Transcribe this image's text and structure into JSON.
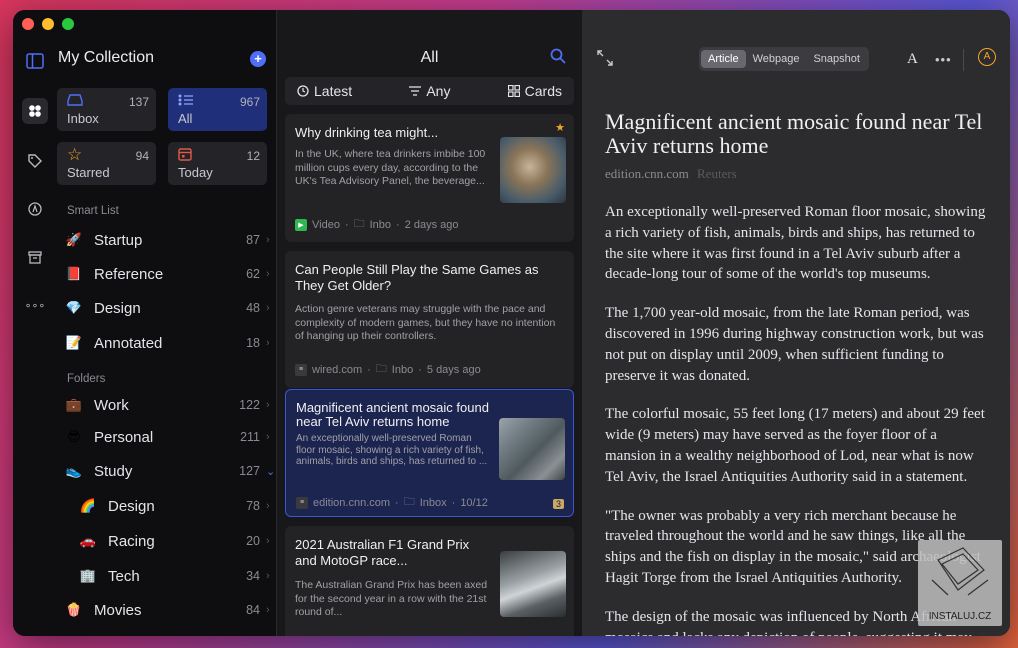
{
  "sidebar": {
    "collection_title": "My Collection",
    "add_icon": "plus-icon",
    "tiles": [
      {
        "label": "Inbox",
        "count": "137",
        "icon": "inbox-icon"
      },
      {
        "label": "All",
        "count": "967",
        "icon": "list-icon"
      },
      {
        "label": "Starred",
        "count": "94",
        "icon": "star-icon"
      },
      {
        "label": "Today",
        "count": "12",
        "icon": "calendar-icon"
      }
    ],
    "smart_list_title": "Smart List",
    "smart_list": [
      {
        "label": "Startup",
        "count": "87",
        "icon": "🚀"
      },
      {
        "label": "Reference",
        "count": "62",
        "icon": "📕"
      },
      {
        "label": "Design",
        "count": "48",
        "icon": "💎"
      },
      {
        "label": "Annotated",
        "count": "18",
        "icon": "📝"
      }
    ],
    "folders_title": "Folders",
    "folders": [
      {
        "label": "Work",
        "count": "122",
        "icon": "💼"
      },
      {
        "label": "Personal",
        "count": "211",
        "icon": "😎"
      },
      {
        "label": "Study",
        "count": "127",
        "icon": "👟"
      },
      {
        "label": "Design",
        "count": "78",
        "icon": "🌈"
      },
      {
        "label": "Racing",
        "count": "20",
        "icon": "🚗"
      },
      {
        "label": "Tech",
        "count": "34",
        "icon": "🏢"
      },
      {
        "label": "Movies",
        "count": "84",
        "icon": "🍿"
      }
    ]
  },
  "list": {
    "title": "All",
    "filters": {
      "sort": "Latest",
      "filter": "Any",
      "view": "Cards"
    },
    "cards": [
      {
        "title": "Why drinking tea might...",
        "excerpt": "In the UK, where tea drinkers imbibe 100 million cups every day, according to the UK's Tea Advisory Panel, the beverage...",
        "type": "Video",
        "folder": "Inbo",
        "time": "2 days ago"
      },
      {
        "title": "Can People Still Play the Same Games as They Get Older?",
        "excerpt": "Action genre veterans may struggle with the pace and complexity of modern games, but they have no intention of hanging up their controllers.",
        "source": "wired.com",
        "folder": "Inbo",
        "time": "5 days ago"
      },
      {
        "title": "Magnificent ancient mosaic found near Tel Aviv returns home",
        "excerpt": "An exceptionally well-preserved Roman floor mosaic, showing a rich variety of fish, animals, birds and ships, has returned to ...",
        "source": "edition.cnn.com",
        "folder": "Inbox",
        "time": "10/12",
        "badge": "3"
      },
      {
        "title": "2021 Australian F1 Grand Prix and MotoGP race...",
        "excerpt": "The Australian Grand Prix has been axed for the second year in a row with the 21st round of..."
      }
    ]
  },
  "reader": {
    "segments": [
      "Article",
      "Webpage",
      "Snapshot"
    ],
    "title": "Magnificent ancient mosaic found near Tel Aviv returns home",
    "source": "edition.cnn.com",
    "author": "Reuters",
    "paragraphs": [
      "An exceptionally well-preserved Roman floor mosaic, showing a rich variety of fish, animals, birds and ships, has returned to the site where it was first found in a Tel Aviv suburb after a decade-long tour of some of the world's top museums.",
      "The 1,700 year-old mosaic, from the late Roman period, was discovered in 1996 during highway construction work, but was not put on display until 2009, when sufficient funding to preserve it was donated.",
      "The colorful mosaic, 55 feet long (17 meters) and about 29 feet wide (9 meters) may have served as the foyer floor of a mansion in a wealthy neighborhood of Lod, near what is now Tel Aviv, the Israel Antiquities Authority said in a statement.",
      "\"The owner was probably a very rich merchant because he traveled throughout the world and he saw things, like all the ships and the fish on display in the mosaic,\" said archaeologist Hagit Torge from the Israel Antiquities Authority.",
      "The design of the mosaic was influenced by North African mosaics and lacks any depiction of people, suggesting it may"
    ],
    "font_button": "A",
    "more_button": "•••"
  },
  "watermark": {
    "text": "INSTALUJ.CZ"
  }
}
